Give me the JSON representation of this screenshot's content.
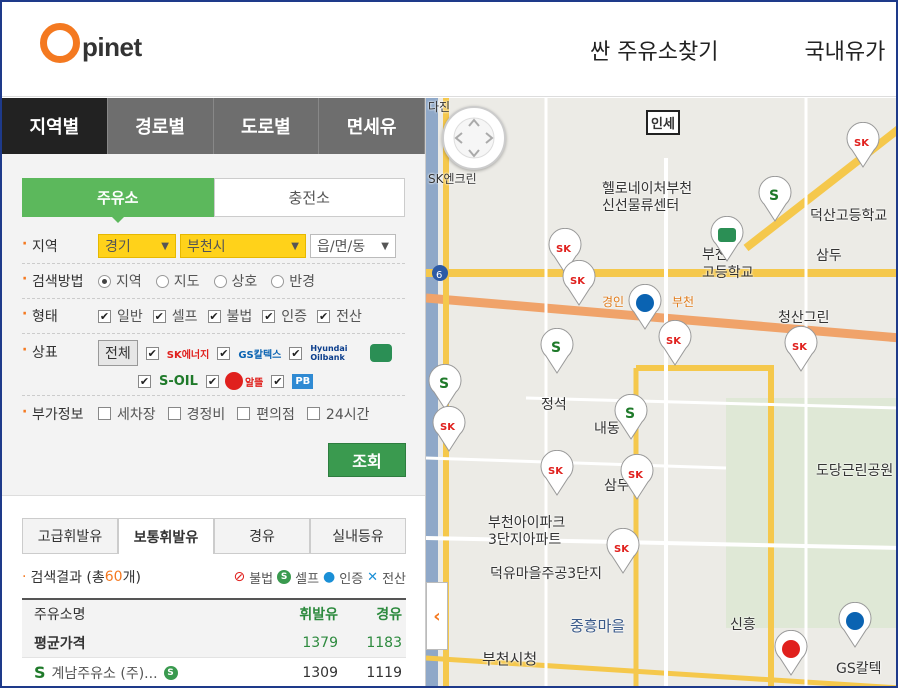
{
  "header": {
    "logo_letter": "O",
    "logo_text": "pinet",
    "nav": [
      "싼 주유소찾기",
      "국내유가"
    ]
  },
  "search_tabs": [
    "지역별",
    "경로별",
    "도로별",
    "면세유"
  ],
  "station_type_tabs": [
    "주유소",
    "충전소"
  ],
  "filters": {
    "region_label": "지역",
    "province": "경기",
    "city": "부천시",
    "district_placeholder": "읍/면/동",
    "method_label": "검색방법",
    "methods": [
      "지역",
      "지도",
      "상호",
      "반경"
    ],
    "type_label": "형태",
    "types": [
      "일반",
      "셀프",
      "불법",
      "인증",
      "전산"
    ],
    "brand_label": "상표",
    "all_label": "전체",
    "brands": [
      "SK에너지",
      "GS칼텍스",
      "Hyundai Oilbank",
      "S-OIL",
      "알뜰",
      "PB"
    ],
    "extra_label": "부가정보",
    "extras": [
      "세차장",
      "경정비",
      "편의점",
      "24시간"
    ],
    "search_button": "조회"
  },
  "fuel_tabs": [
    "고급휘발유",
    "보통휘발유",
    "경유",
    "실내등유"
  ],
  "results": {
    "prefix": "검색결과 (총 ",
    "count": "60",
    "suffix": "개)",
    "legend": [
      "불법",
      "셀프",
      "인증",
      "전산"
    ],
    "columns": [
      "주유소명",
      "휘발유",
      "경유"
    ],
    "average_label": "평균가격",
    "average_gasoline": "1379",
    "average_diesel": "1183",
    "rows": [
      {
        "name": "계남주유소 (주)...",
        "gasoline": "1309",
        "diesel": "1119"
      }
    ]
  },
  "map": {
    "labels": [
      "헬로네이처부천",
      "신선물류센터",
      "덕산고등학교",
      "삼두",
      "고등학교",
      "부천",
      "경인",
      "부천",
      "청산그린",
      "정석",
      "내동",
      "삼두",
      "도당근린공원",
      "부천아이파크",
      "3단지아파트",
      "덕유마을주공3단지",
      "중흥마을",
      "부천시청",
      "신흥",
      "GS칼텍",
      "인세",
      "SK엔크린",
      "다진"
    ],
    "road_number": "6"
  }
}
